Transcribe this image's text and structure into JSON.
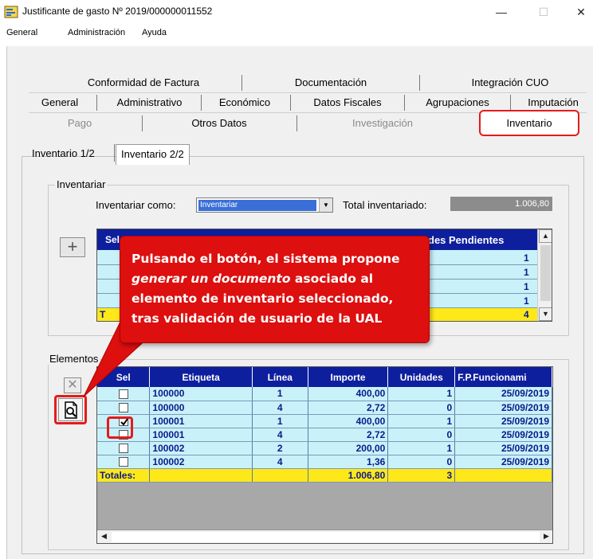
{
  "window": {
    "title": "Justificante de gasto Nº 2019/000000011552",
    "minimize": "—",
    "maximize": "☐",
    "close": "✕"
  },
  "menu": [
    "General",
    "Administración",
    "Ayuda"
  ],
  "tabs": {
    "row1": [
      "Conformidad de Factura",
      "Documentación",
      "Integración CUO"
    ],
    "row2": [
      "General",
      "Administrativo",
      "Económico",
      "Datos Fiscales",
      "Agrupaciones",
      "Imputación"
    ],
    "row3": [
      "Pago",
      "Otros Datos",
      "Investigación",
      "Inventario"
    ]
  },
  "subtabs": [
    "Inventario 1/2",
    "Inventario 2/2"
  ],
  "inventariar": {
    "group_label": "Inventariar",
    "como_label": "Inventariar como:",
    "como_value": "Inventariar",
    "total_label": "Total inventariado:",
    "total_value": "1.006,80",
    "add_button": "+",
    "grid_header_partial_left": "Sel",
    "grid_header_partial_right": "des Pendientes",
    "rows_right_values": [
      "1",
      "1",
      "1",
      "1"
    ],
    "totals_partial": "T",
    "totals_right": "4"
  },
  "elementos": {
    "group_label": "Elementos",
    "columns": [
      "Sel",
      "Etiqueta",
      "Línea",
      "Importe",
      "Unidades",
      "F.P.Funcionami"
    ],
    "rows": [
      {
        "checked": false,
        "etiqueta": "100000",
        "linea": "1",
        "importe": "400,00",
        "unidades": "1",
        "fecha": "25/09/2019"
      },
      {
        "checked": false,
        "etiqueta": "100000",
        "linea": "4",
        "importe": "2,72",
        "unidades": "0",
        "fecha": "25/09/2019"
      },
      {
        "checked": true,
        "etiqueta": "100001",
        "linea": "1",
        "importe": "400,00",
        "unidades": "1",
        "fecha": "25/09/2019"
      },
      {
        "checked": false,
        "etiqueta": "100001",
        "linea": "4",
        "importe": "2,72",
        "unidades": "0",
        "fecha": "25/09/2019"
      },
      {
        "checked": false,
        "etiqueta": "100002",
        "linea": "2",
        "importe": "200,00",
        "unidades": "1",
        "fecha": "25/09/2019"
      },
      {
        "checked": false,
        "etiqueta": "100002",
        "linea": "4",
        "importe": "1,36",
        "unidades": "0",
        "fecha": "25/09/2019"
      }
    ],
    "totals": {
      "label": "Totales:",
      "importe": "1.006,80",
      "unidades": "3"
    }
  },
  "callout": {
    "line1": "Pulsando el botón, el sistema propone",
    "italic": "generar un documento",
    "line2_rest": " asociado al",
    "line3": "elemento de inventario seleccionado,",
    "line4": "tras validación de usuario de la UAL"
  },
  "colors": {
    "accent_red": "#e41b1b",
    "grid_header": "#0e1f9e",
    "grid_row": "#c9f1f9",
    "totals": "#ffe81a"
  }
}
